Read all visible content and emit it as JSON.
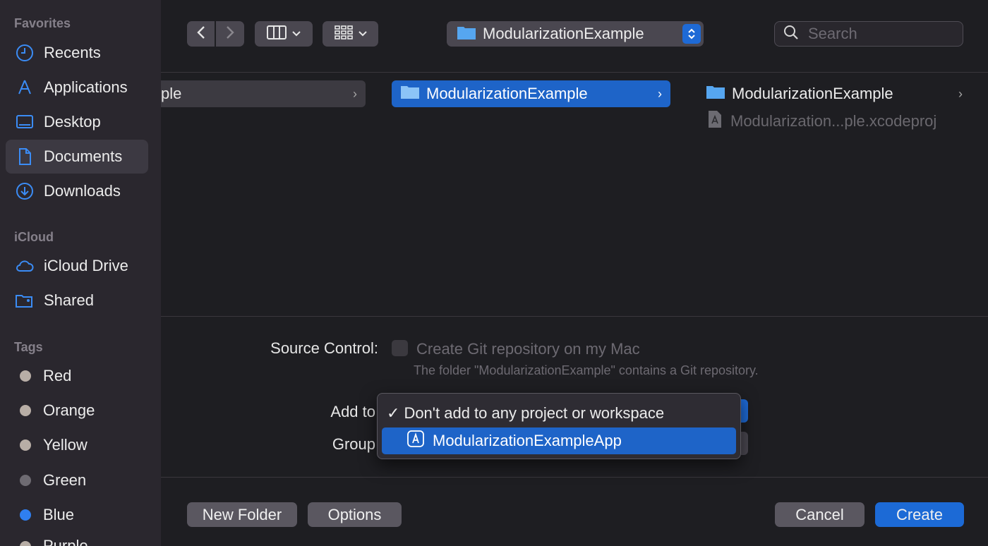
{
  "sidebar": {
    "favorites_header": "Favorites",
    "favorites": [
      {
        "label": "Recents",
        "icon": "clock-icon"
      },
      {
        "label": "Applications",
        "icon": "applications-icon"
      },
      {
        "label": "Desktop",
        "icon": "desktop-icon"
      },
      {
        "label": "Documents",
        "icon": "document-icon",
        "selected": true
      },
      {
        "label": "Downloads",
        "icon": "download-icon"
      }
    ],
    "icloud_header": "iCloud",
    "icloud": [
      {
        "label": "iCloud Drive",
        "icon": "cloud-icon"
      },
      {
        "label": "Shared",
        "icon": "shared-folder-icon"
      }
    ],
    "tags_header": "Tags",
    "tags": [
      {
        "label": "Red",
        "color": "#b8aea6"
      },
      {
        "label": "Orange",
        "color": "#b8aea6"
      },
      {
        "label": "Yellow",
        "color": "#b8aea6"
      },
      {
        "label": "Green",
        "color": "#6e6b72"
      },
      {
        "label": "Blue",
        "color": "#2f7ff0"
      },
      {
        "label": "Purple",
        "color": "#b8aea6"
      }
    ]
  },
  "toolbar": {
    "location": "ModularizationExample",
    "search_placeholder": "Search"
  },
  "browser": {
    "col1_item": "ple",
    "col2_item": "ModularizationExample",
    "col3_items": [
      "ModularizationExample",
      "Modularization...ple.xcodeproj"
    ]
  },
  "form": {
    "source_control_label": "Source Control:",
    "git_checkbox_label": "Create Git repository on my Mac",
    "git_note": "The folder \"ModularizationExample\" contains a Git repository.",
    "add_to_label": "Add to",
    "group_label": "Group"
  },
  "popup": {
    "checkmark": "✓",
    "items": [
      "Don't add to any project or workspace",
      "ModularizationExampleApp"
    ]
  },
  "buttons": {
    "new_folder": "New Folder",
    "options": "Options",
    "cancel": "Cancel",
    "create": "Create"
  }
}
